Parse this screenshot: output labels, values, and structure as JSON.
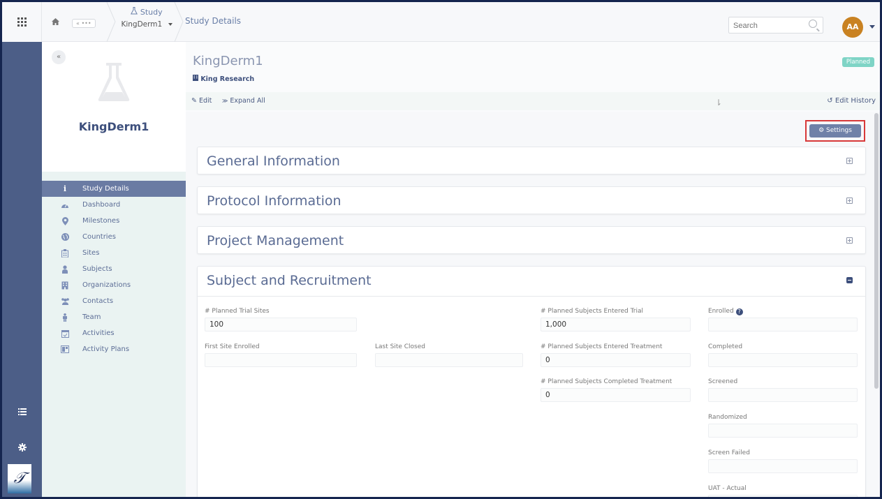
{
  "topbar": {
    "study_label": "Study",
    "study_name": "KingDerm1",
    "current_page": "Study Details",
    "collapsed_crumbs": "« •••",
    "search_placeholder": "Search",
    "avatar_initials": "AA"
  },
  "sidebar": {
    "study_title": "KingDerm1",
    "items": [
      {
        "label": "Study Details",
        "icon": "info-icon"
      },
      {
        "label": "Dashboard",
        "icon": "dashboard-icon"
      },
      {
        "label": "Milestones",
        "icon": "map-marker-icon"
      },
      {
        "label": "Countries",
        "icon": "globe-icon"
      },
      {
        "label": "Sites",
        "icon": "hospital-icon"
      },
      {
        "label": "Subjects",
        "icon": "person-icon"
      },
      {
        "label": "Organizations",
        "icon": "building-icon"
      },
      {
        "label": "Contacts",
        "icon": "users-icon"
      },
      {
        "label": "Team",
        "icon": "team-icon"
      },
      {
        "label": "Activities",
        "icon": "calendar-check-icon"
      },
      {
        "label": "Activity Plans",
        "icon": "plan-icon"
      }
    ]
  },
  "header": {
    "title": "KingDerm1",
    "organization": "King Research",
    "status": "Planned",
    "edit_label": "Edit",
    "expand_label": "Expand All",
    "history_label": "Edit History"
  },
  "settings_label": "Settings",
  "panels": [
    {
      "title": "General Information"
    },
    {
      "title": "Protocol Information"
    },
    {
      "title": "Project Management"
    },
    {
      "title": "Subject and Recruitment"
    }
  ],
  "fields": {
    "planned_trial_sites": {
      "label": "# Planned Trial Sites",
      "value": "100"
    },
    "first_site_enrolled": {
      "label": "First Site Enrolled",
      "value": ""
    },
    "last_site_closed": {
      "label": "Last Site Closed",
      "value": ""
    },
    "planned_subjects_entered_trial": {
      "label": "# Planned Subjects Entered Trial",
      "value": "1,000"
    },
    "planned_subjects_entered_treatment": {
      "label": "# Planned Subjects Entered Treatment",
      "value": "0"
    },
    "planned_subjects_completed_treatment": {
      "label": "# Planned Subjects Completed Treatment",
      "value": "0"
    },
    "enrolled": {
      "label": "Enrolled",
      "value": ""
    },
    "completed": {
      "label": "Completed",
      "value": ""
    },
    "screened": {
      "label": "Screened",
      "value": ""
    },
    "randomized": {
      "label": "Randomized",
      "value": ""
    },
    "screen_failed": {
      "label": "Screen Failed",
      "value": ""
    },
    "uat_actual": {
      "label": "UAT - Actual",
      "value": ""
    }
  },
  "colors": {
    "rail": "#4c5e87",
    "sidebar_bg": "#eaf3f2",
    "active_nav": "#6a7ba3",
    "accent_text": "#3d4f7c",
    "status_badge": "#7fd4c6",
    "avatar": "#c98222",
    "highlight_border": "#d83939"
  }
}
